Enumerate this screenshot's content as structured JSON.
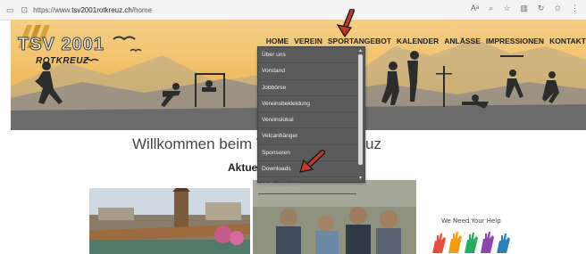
{
  "browser": {
    "url_prefix": "https://www.",
    "url_domain": "tsv2001rotkreuz.ch",
    "url_path": "/home"
  },
  "logo": {
    "line1": "TSV 2001",
    "line2": "ROTKREUZ"
  },
  "nav": [
    "HOME",
    "VEREIN",
    "SPORTANGEBOT",
    "KALENDER",
    "ANLÄSSE",
    "IMPRESSIONEN",
    "KONTAKT"
  ],
  "dropdown": {
    "items": [
      "Über uns",
      "Vorstand",
      "Jobbörse",
      "Vereinsbekleidung",
      "Vereinslokal",
      "Velcanhänger",
      "Sponsoren",
      "Downloads",
      "Helferemsatz"
    ],
    "highlighted_index": 8
  },
  "welcome": {
    "left": "Willkommen beim T",
    "right": "uz"
  },
  "section_title": "Aktuel",
  "help_banner": "We Need Your Help",
  "colors": {
    "hero_sky": "#f1c46f",
    "menu_bg": "#5a5a5a",
    "arrow": "#c0392b"
  }
}
